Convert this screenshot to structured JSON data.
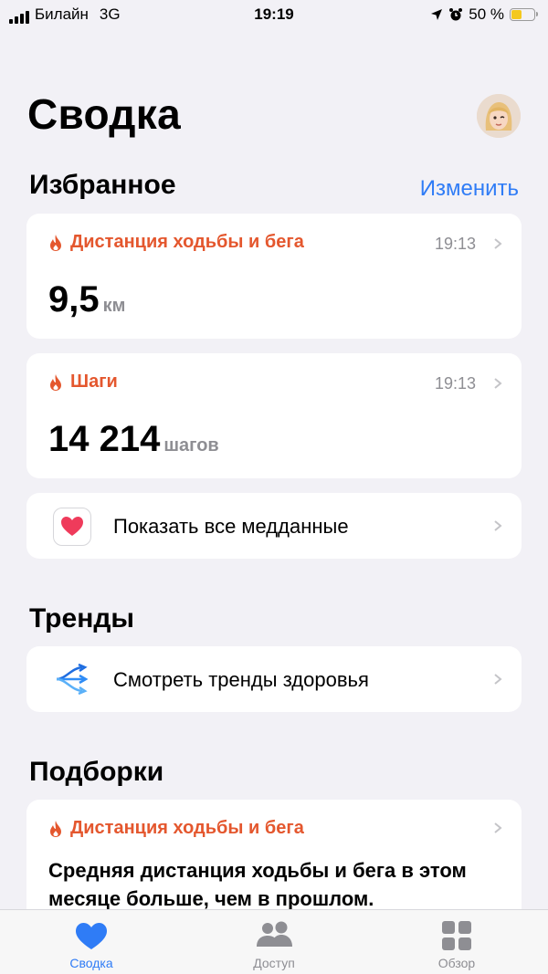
{
  "status_bar": {
    "carrier": "Билайн",
    "network": "3G",
    "time": "19:19",
    "battery": "50 %",
    "battery_level": 0.5
  },
  "header": {
    "title": "Сводка"
  },
  "favorites": {
    "title": "Избранное",
    "edit_label": "Изменить",
    "items": [
      {
        "label": "Дистанция ходьбы и бега",
        "time": "19:13",
        "value": "9,5",
        "unit": "км"
      },
      {
        "label": "Шаги",
        "time": "19:13",
        "value": "14 214",
        "unit": "шагов"
      }
    ],
    "show_all_label": "Показать все медданные"
  },
  "trends": {
    "title": "Тренды",
    "row_label": "Смотреть тренды здоровья"
  },
  "highlights": {
    "title": "Подборки",
    "card": {
      "label": "Дистанция ходьбы и бега",
      "text": "Средняя дистанция ходьбы и бега в этом месяце больше, чем в прошлом."
    }
  },
  "tabbar": {
    "items": [
      {
        "label": "Сводка"
      },
      {
        "label": "Доступ"
      },
      {
        "label": "Обзор"
      }
    ]
  },
  "colors": {
    "accent": "#2f7cf6",
    "activity": "#e4572e",
    "background": "#f2f1f6"
  }
}
